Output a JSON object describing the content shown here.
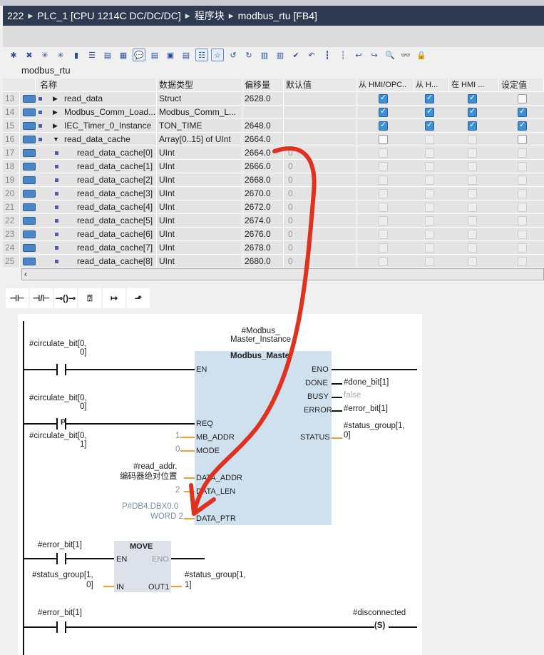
{
  "breadcrumb": [
    "222",
    "PLC_1 [CPU 1214C DC/DC/DC]",
    "程序块",
    "modbus_rtu [FB4]"
  ],
  "block_title": "modbus_rtu",
  "columns": [
    "名称",
    "数据类型",
    "偏移量",
    "默认值",
    "从 HMI/OPC..",
    "从 H...",
    "在 HMI ...",
    "设定值"
  ],
  "rows": [
    {
      "num": "13",
      "name": "read_data",
      "type": "Struct",
      "offset": "2628.0",
      "default": "",
      "expand": "▶",
      "indent": 0,
      "cb": [
        "on",
        "on",
        "on",
        "off"
      ]
    },
    {
      "num": "14",
      "name": "Modbus_Comm_Load...",
      "type": "Modbus_Comm_L...",
      "offset": "",
      "default": "",
      "expand": "▶",
      "indent": 0,
      "cb": [
        "on",
        "on",
        "on",
        "on"
      ]
    },
    {
      "num": "15",
      "name": "IEC_Timer_0_Instance",
      "type": "TON_TIME",
      "offset": "2648.0",
      "default": "",
      "expand": "▶",
      "indent": 0,
      "cb": [
        "on",
        "on",
        "on",
        "on"
      ]
    },
    {
      "num": "16",
      "name": "read_data_cache",
      "type": "Array[0..15] of UInt",
      "offset": "2664.0",
      "default": "",
      "expand": "▼",
      "indent": 0,
      "cb": [
        "off",
        "dis",
        "dis",
        "off"
      ]
    },
    {
      "num": "17",
      "name": "read_data_cache[0]",
      "type": "UInt",
      "offset": "2664.0",
      "default": "0",
      "expand": "",
      "indent": 1,
      "cb": [
        "dis",
        "dis",
        "dis",
        "dis"
      ]
    },
    {
      "num": "18",
      "name": "read_data_cache[1]",
      "type": "UInt",
      "offset": "2666.0",
      "default": "0",
      "expand": "",
      "indent": 1,
      "cb": [
        "dis",
        "dis",
        "dis",
        "dis"
      ]
    },
    {
      "num": "19",
      "name": "read_data_cache[2]",
      "type": "UInt",
      "offset": "2668.0",
      "default": "0",
      "expand": "",
      "indent": 1,
      "cb": [
        "dis",
        "dis",
        "dis",
        "dis"
      ]
    },
    {
      "num": "20",
      "name": "read_data_cache[3]",
      "type": "UInt",
      "offset": "2670.0",
      "default": "0",
      "expand": "",
      "indent": 1,
      "cb": [
        "dis",
        "dis",
        "dis",
        "dis"
      ]
    },
    {
      "num": "21",
      "name": "read_data_cache[4]",
      "type": "UInt",
      "offset": "2672.0",
      "default": "0",
      "expand": "",
      "indent": 1,
      "cb": [
        "dis",
        "dis",
        "dis",
        "dis"
      ]
    },
    {
      "num": "22",
      "name": "read_data_cache[5]",
      "type": "UInt",
      "offset": "2674.0",
      "default": "0",
      "expand": "",
      "indent": 1,
      "cb": [
        "dis",
        "dis",
        "dis",
        "dis"
      ]
    },
    {
      "num": "23",
      "name": "read_data_cache[6]",
      "type": "UInt",
      "offset": "2676.0",
      "default": "0",
      "expand": "",
      "indent": 1,
      "cb": [
        "dis",
        "dis",
        "dis",
        "dis"
      ]
    },
    {
      "num": "24",
      "name": "read_data_cache[7]",
      "type": "UInt",
      "offset": "2678.0",
      "default": "0",
      "expand": "",
      "indent": 1,
      "cb": [
        "dis",
        "dis",
        "dis",
        "dis"
      ]
    },
    {
      "num": "25",
      "name": "read_data_cache[8]",
      "type": "UInt",
      "offset": "2680.0",
      "default": "0",
      "expand": "",
      "indent": 1,
      "cb": [
        "dis",
        "dis",
        "dis",
        "dis"
      ]
    }
  ],
  "instructions": [
    "⊣⊢",
    "⊣/⊢",
    "⊸()⊸",
    "⍰",
    "↦",
    "⬏"
  ],
  "ladder": {
    "instance": "#Modbus_\nMaster_Instance",
    "block": "Modbus_Master",
    "contact1": "#circulate_bit[0,\n0]",
    "contact2": "#circulate_bit[0,\n0]",
    "contact2_type": "P",
    "contact3": "#circulate_bit[0,\n1]",
    "pins_in": [
      "EN",
      "REQ",
      "MB_ADDR",
      "MODE",
      "DATA_ADDR",
      "DATA_LEN",
      "DATA_PTR"
    ],
    "pins_out": [
      "ENO",
      "DONE",
      "BUSY",
      "ERROR",
      "STATUS"
    ],
    "mb_addr": "1",
    "mode": "0",
    "data_addr": "#read_addr.\n编码器绝对位置",
    "data_len": "2",
    "data_ptr1": "P#DB4.DBX0.0",
    "data_ptr2": "WORD 2",
    "done": "#done_bit[1]",
    "busy": "false",
    "error": "#error_bit[1]",
    "status": "#status_group[1,\n0]",
    "move_contact": "#error_bit[1]",
    "move_title": "MOVE",
    "move_en": "EN",
    "move_eno": "ENO",
    "move_in": "IN",
    "move_out": "OUT1",
    "move_in_val": "#status_group[1,\n0]",
    "move_out_val": "#status_group[1,\n1]",
    "set_contact": "#error_bit[1]",
    "set_coil": "#disconnected",
    "set_coil_type": "S"
  },
  "colors": {
    "header": "#2e3a52",
    "block": "#cfe0ef",
    "annotation": "#e0301e",
    "wire_orange": "#f0a030"
  }
}
